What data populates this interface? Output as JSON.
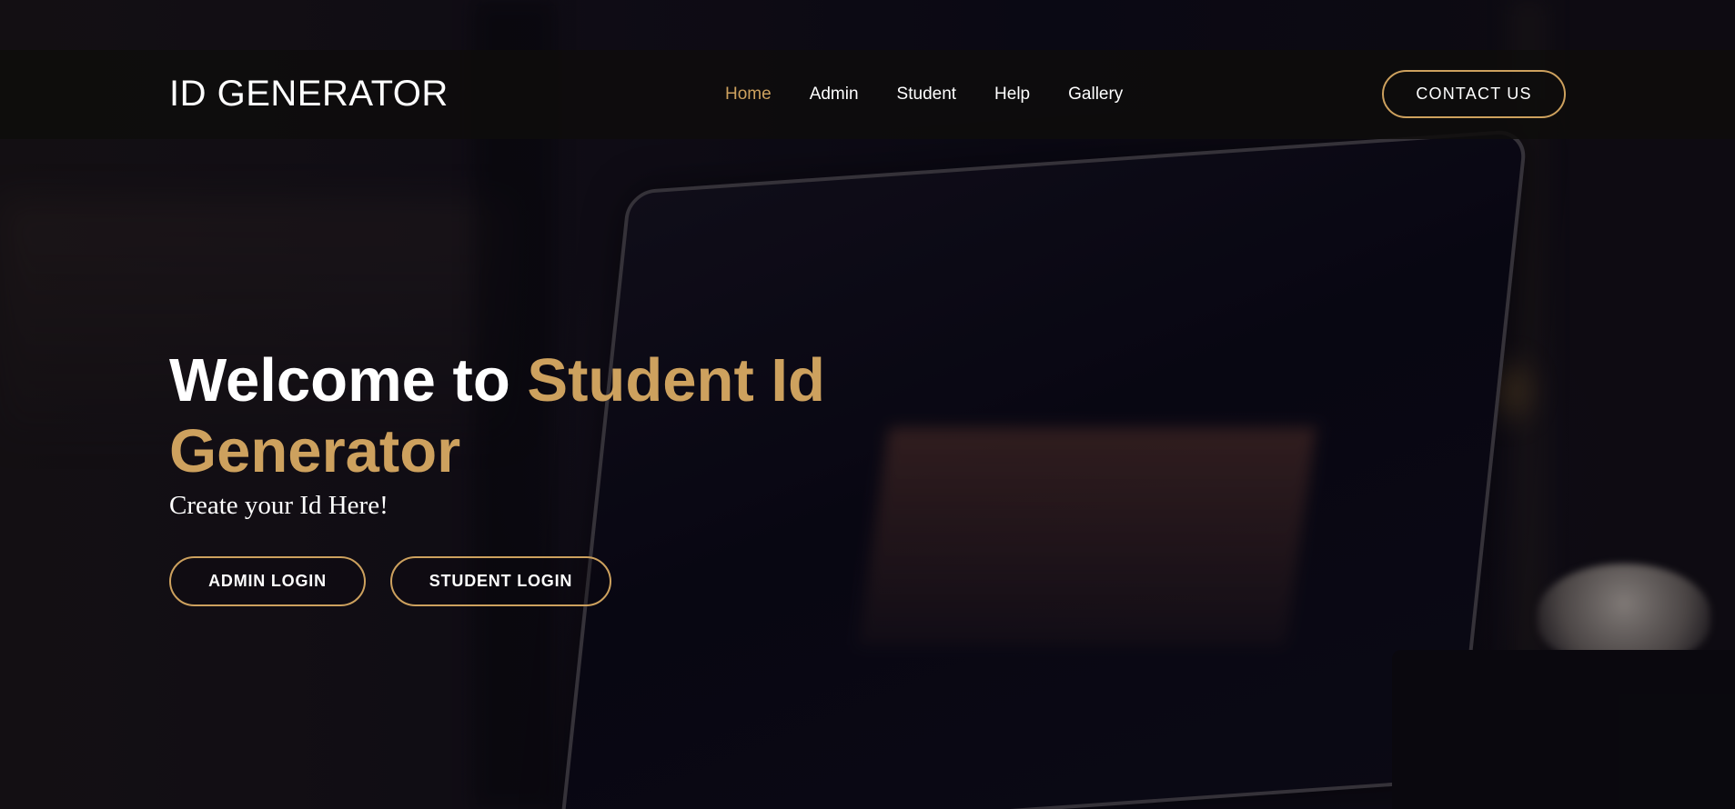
{
  "navbar": {
    "brand": "ID GENERATOR",
    "links": [
      {
        "label": "Home",
        "active": true
      },
      {
        "label": "Admin",
        "active": false
      },
      {
        "label": "Student",
        "active": false
      },
      {
        "label": "Help",
        "active": false
      },
      {
        "label": "Gallery",
        "active": false
      }
    ],
    "contact_label": "CONTACT US"
  },
  "hero": {
    "title_prefix": "Welcome to ",
    "title_accent": "Student Id Generator",
    "subtitle": "Create your Id Here!",
    "admin_login_label": "ADMIN LOGIN",
    "student_login_label": "STUDENT LOGIN"
  },
  "colors": {
    "accent": "#cda15e",
    "navbar_bg": "#0e0d0c",
    "text": "#ffffff"
  }
}
